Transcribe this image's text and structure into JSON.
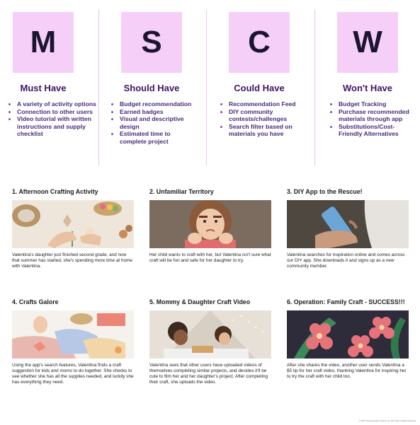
{
  "columns": [
    {
      "letter": "M",
      "heading": "Must Have",
      "items": [
        "A variety of activity options",
        "Connection to other users",
        "Video tutorial with written instructions and supply checklist"
      ]
    },
    {
      "letter": "S",
      "heading": "Should Have",
      "items": [
        "Budget recommendation",
        "Earned badges",
        "Visual and descriptive design",
        "Estimated time to complete project"
      ]
    },
    {
      "letter": "C",
      "heading": "Could Have",
      "items": [
        "Recommendation Feed",
        "DIY community contests/challenges",
        "Search filter based on materials you have"
      ]
    },
    {
      "letter": "W",
      "heading": "Won't Have",
      "items": [
        "Budget Tracking",
        "Purchase recommended materials through app",
        "Substitutions/Cost-Friendly Alternatives"
      ]
    }
  ],
  "panels": [
    {
      "title": "1. Afternoon Crafting Activity",
      "caption": "Valentina's daughter just finished second grade, and now that summer has started, she's spending more time at home with Valentina.",
      "photo": "crafting-table"
    },
    {
      "title": "2. Unfamiliar Territory",
      "caption": "Her child wants to craft with her, but Valentina isn't sure what craft will be fun and safe for her daughter to try.",
      "photo": "pouting-girl"
    },
    {
      "title": "3. DIY App to the Rescue!",
      "caption": "Valentina searches for inspiration online and comes across our DIY app. She downloads it and signs up as a new community member.",
      "photo": "phone-in-hand"
    },
    {
      "title": "4. Crafts Galore",
      "caption": "Using the app's search features, Valentina finds a craft suggestion for kids and moms to do together. She checks to see whether she has all the supplies needed, and luckily she has everything they need.",
      "photo": "paper-crafts"
    },
    {
      "title": "5. Mommy & Daughter Craft Video",
      "caption": "Valentina sees that other users have uploaded videos of themselves completing similar projects, and decides it'll be cute to film her and her daughter's project. After completing their craft, she uploads the video.",
      "photo": "mother-daughter-tent"
    },
    {
      "title": "6. Operation: Family Craft - SUCCESS!!!",
      "caption": "After she shares the video, another user sends Valentina a $5 tip for her craft video, thanking Valentina for inspiring her to try the craft with her child too.",
      "photo": "paper-flowers"
    }
  ],
  "copyright": "© 2023 Things Education Services, LLC dba Yellow, All Rights Reserved"
}
